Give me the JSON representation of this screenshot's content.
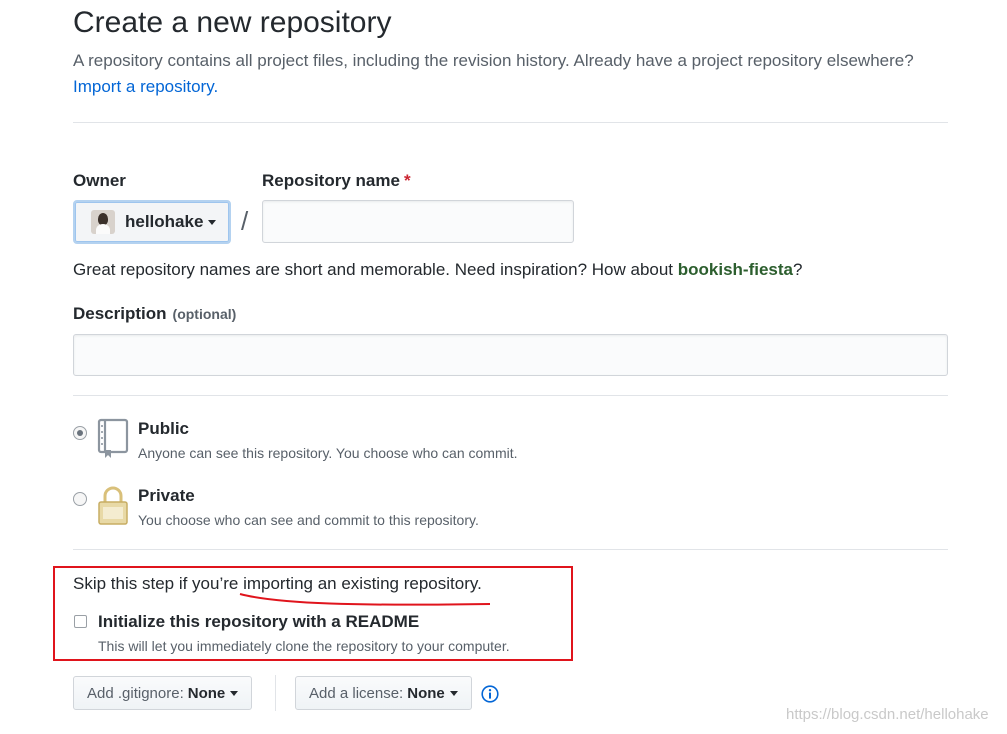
{
  "header": {
    "title": "Create a new repository",
    "subtitle": "A repository contains all project files, including the revision history. Already have a project repository elsewhere?",
    "import_link": "Import a repository."
  },
  "owner": {
    "label": "Owner",
    "value": "hellohake"
  },
  "repo_name": {
    "label": "Repository name",
    "required_mark": "*",
    "value": "",
    "separator": "/"
  },
  "name_hint": {
    "text": "Great repository names are short and memorable. Need inspiration? How about",
    "suggestion": "bookish-fiesta",
    "end": "?"
  },
  "description": {
    "label": "Description",
    "optional": "(optional)",
    "value": ""
  },
  "visibility": {
    "options": [
      {
        "title": "Public",
        "note": "Anyone can see this repository. You choose who can commit.",
        "selected": true,
        "icon": "repo-book-icon"
      },
      {
        "title": "Private",
        "note": "You choose who can see and commit to this repository.",
        "selected": false,
        "icon": "lock-icon"
      }
    ]
  },
  "init": {
    "skip_text": "Skip this step if you’re importing an existing repository.",
    "readme_label": "Initialize this repository with a README",
    "readme_note": "This will let you immediately clone the repository to your computer.",
    "readme_checked": false
  },
  "footer": {
    "gitignore_label": "Add .gitignore:",
    "gitignore_value": "None",
    "license_label": "Add a license:",
    "license_value": "None",
    "info_icon": "info-icon"
  },
  "watermark": "https://blog.csdn.net/hellohake",
  "colors": {
    "link": "#0366d6",
    "callout": "#e0141c",
    "suggestion": "#2c5e2e",
    "required": "#cb2431"
  }
}
